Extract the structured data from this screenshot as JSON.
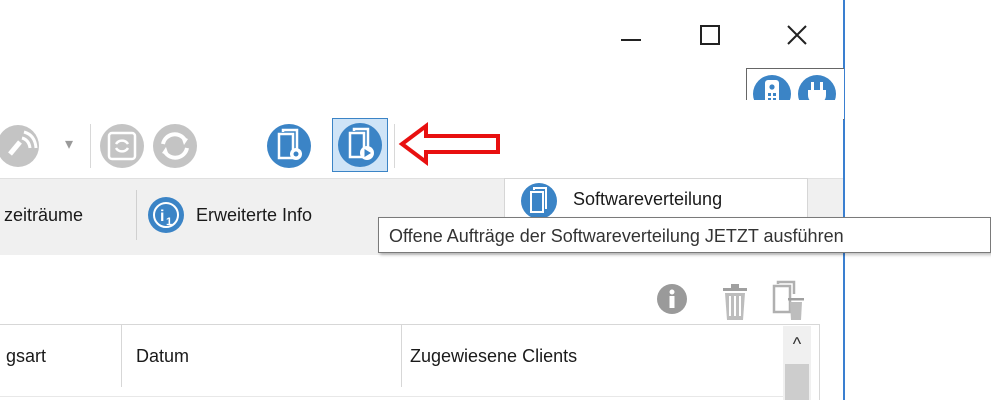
{
  "title_bar": {
    "minimize_glyph": "—",
    "maximize_glyph": "☐",
    "close_glyph": "✕"
  },
  "toolbar": {
    "dropdown_arrow": "▾"
  },
  "tabs": [
    {
      "label": "zeiträume"
    },
    {
      "label": "Erweiterte Info"
    },
    {
      "label": "Softwareverteilung"
    }
  ],
  "tooltip": {
    "text": "Offene Aufträge der Softwareverteilung JETZT ausführen"
  },
  "table": {
    "columns": [
      "gsart",
      "Datum",
      "Zugewiesene Clients"
    ],
    "scroll_up_glyph": "^"
  },
  "colors": {
    "accent_blue": "#3b84c6",
    "window_border": "#3a7fd0",
    "arrow_red": "#e81010",
    "disabled_gray": "#c4c4c4"
  }
}
